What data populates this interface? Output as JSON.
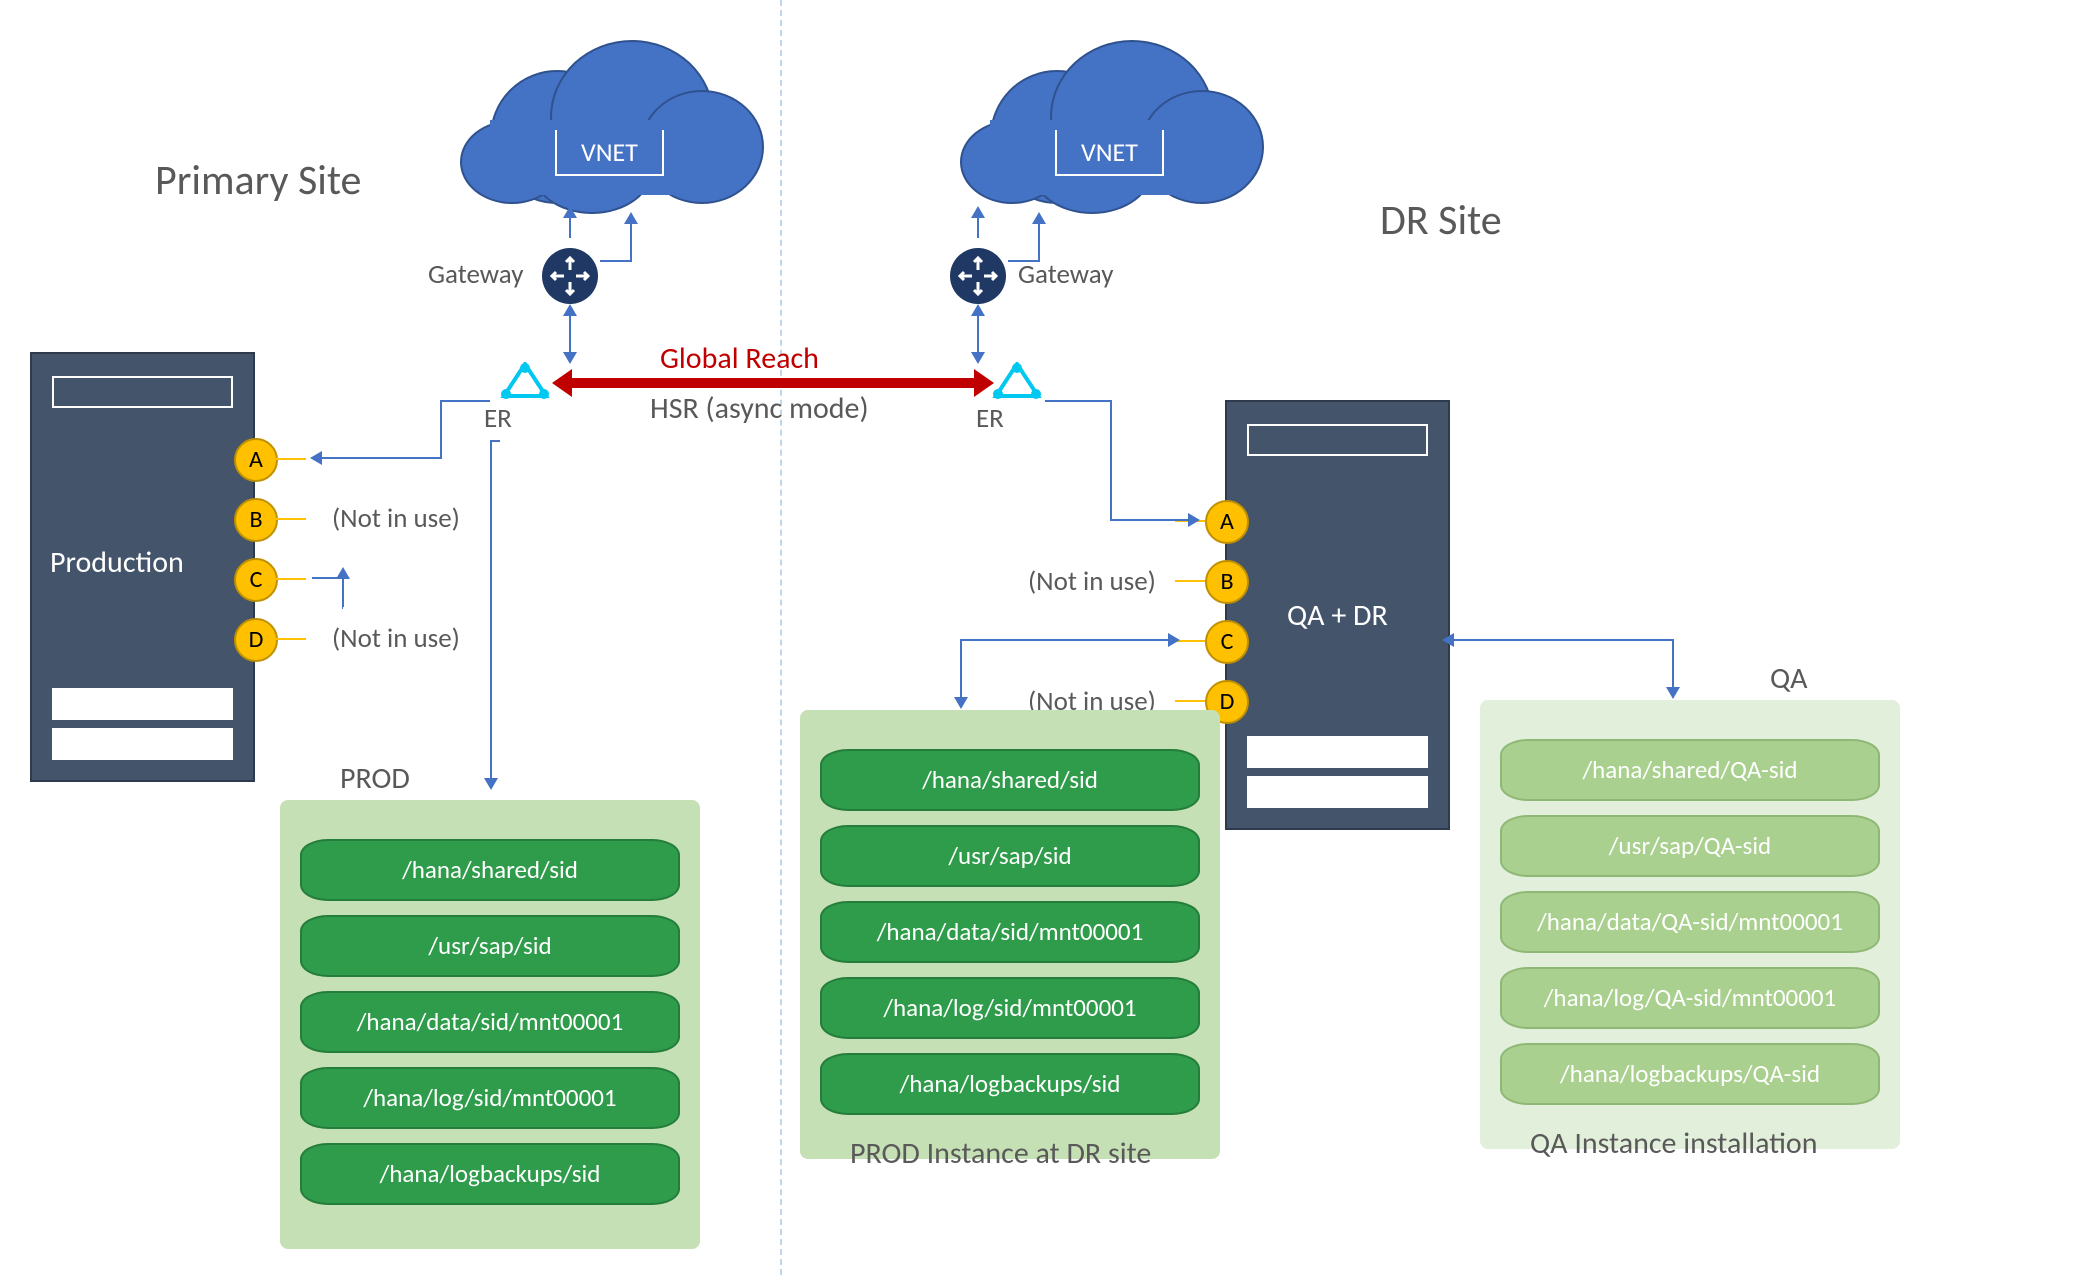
{
  "titles": {
    "primary": "Primary Site",
    "dr": "DR Site"
  },
  "cloud": {
    "vnet": "VNET"
  },
  "gateway": "Gateway",
  "er": "ER",
  "global_reach": {
    "top": "Global Reach",
    "bottom": "HSR (async mode)"
  },
  "servers": {
    "prod": "Production",
    "qadr": "QA + DR"
  },
  "ports": {
    "a": "A",
    "b": "B",
    "c": "C",
    "d": "D"
  },
  "annot": {
    "not_in_use": "(Not in use)"
  },
  "storage": {
    "prod": {
      "title": "PROD",
      "caption": "",
      "disks": [
        "/hana/shared/sid",
        "/usr/sap/sid",
        "/hana/data/sid/mnt00001",
        "/hana/log/sid/mnt00001",
        "/hana/logbackups/sid"
      ]
    },
    "dr": {
      "title": "",
      "caption": "PROD Instance at DR site",
      "disks": [
        "/hana/shared/sid",
        "/usr/sap/sid",
        "/hana/data/sid/mnt00001",
        "/hana/log/sid/mnt00001",
        "/hana/logbackups/sid"
      ]
    },
    "qa": {
      "title": "QA",
      "caption": "QA Instance installation",
      "disks": [
        "/hana/shared/QA-sid",
        "/usr/sap/QA-sid",
        "/hana/data/QA-sid/mnt00001",
        "/hana/log/QA-sid/mnt00001",
        "/hana/logbackups/QA-sid"
      ]
    }
  }
}
